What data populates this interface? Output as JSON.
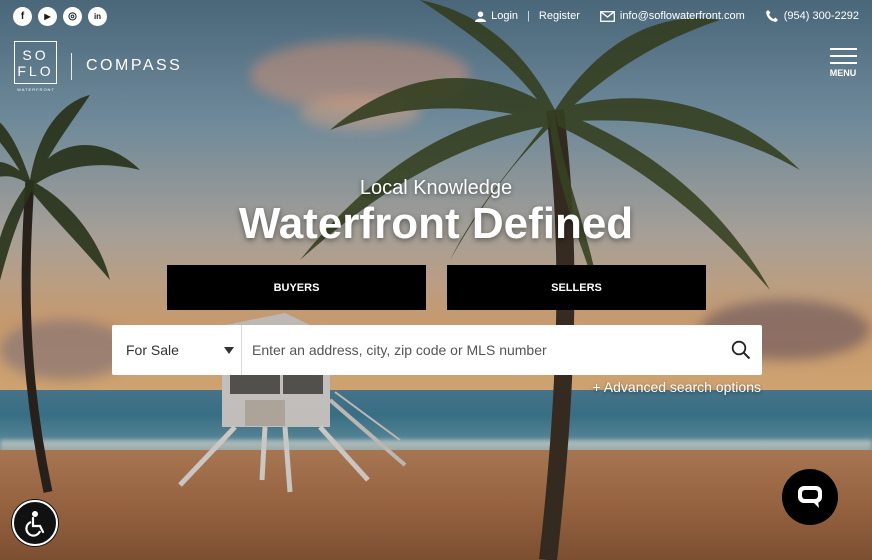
{
  "topbar": {
    "social": [
      {
        "icon": "facebook-icon",
        "glyph": "f"
      },
      {
        "icon": "youtube-icon",
        "glyph": "▶"
      },
      {
        "icon": "instagram-icon",
        "glyph": "◎"
      },
      {
        "icon": "linkedin-icon",
        "glyph": "in"
      }
    ],
    "login_label": "Login",
    "register_label": "Register",
    "email": "info@soflowaterfront.com",
    "phone": "(954) 300-2292"
  },
  "header": {
    "logo_line1": "SO",
    "logo_line2": "FLO",
    "logo_sub": "WATERFRONT",
    "partner": "COMPASS",
    "menu_label": "MENU"
  },
  "hero": {
    "tagline": "Local Knowledge",
    "headline": "Waterfront Defined",
    "buyers_label": "BUYERS",
    "sellers_label": "SELLERS"
  },
  "search": {
    "type_value": "For Sale",
    "placeholder": "Enter an address, city, zip code or MLS number",
    "advanced_label": "+ Advanced search options"
  },
  "colors": {
    "button_bg": "#000000",
    "text": "#ffffff"
  }
}
